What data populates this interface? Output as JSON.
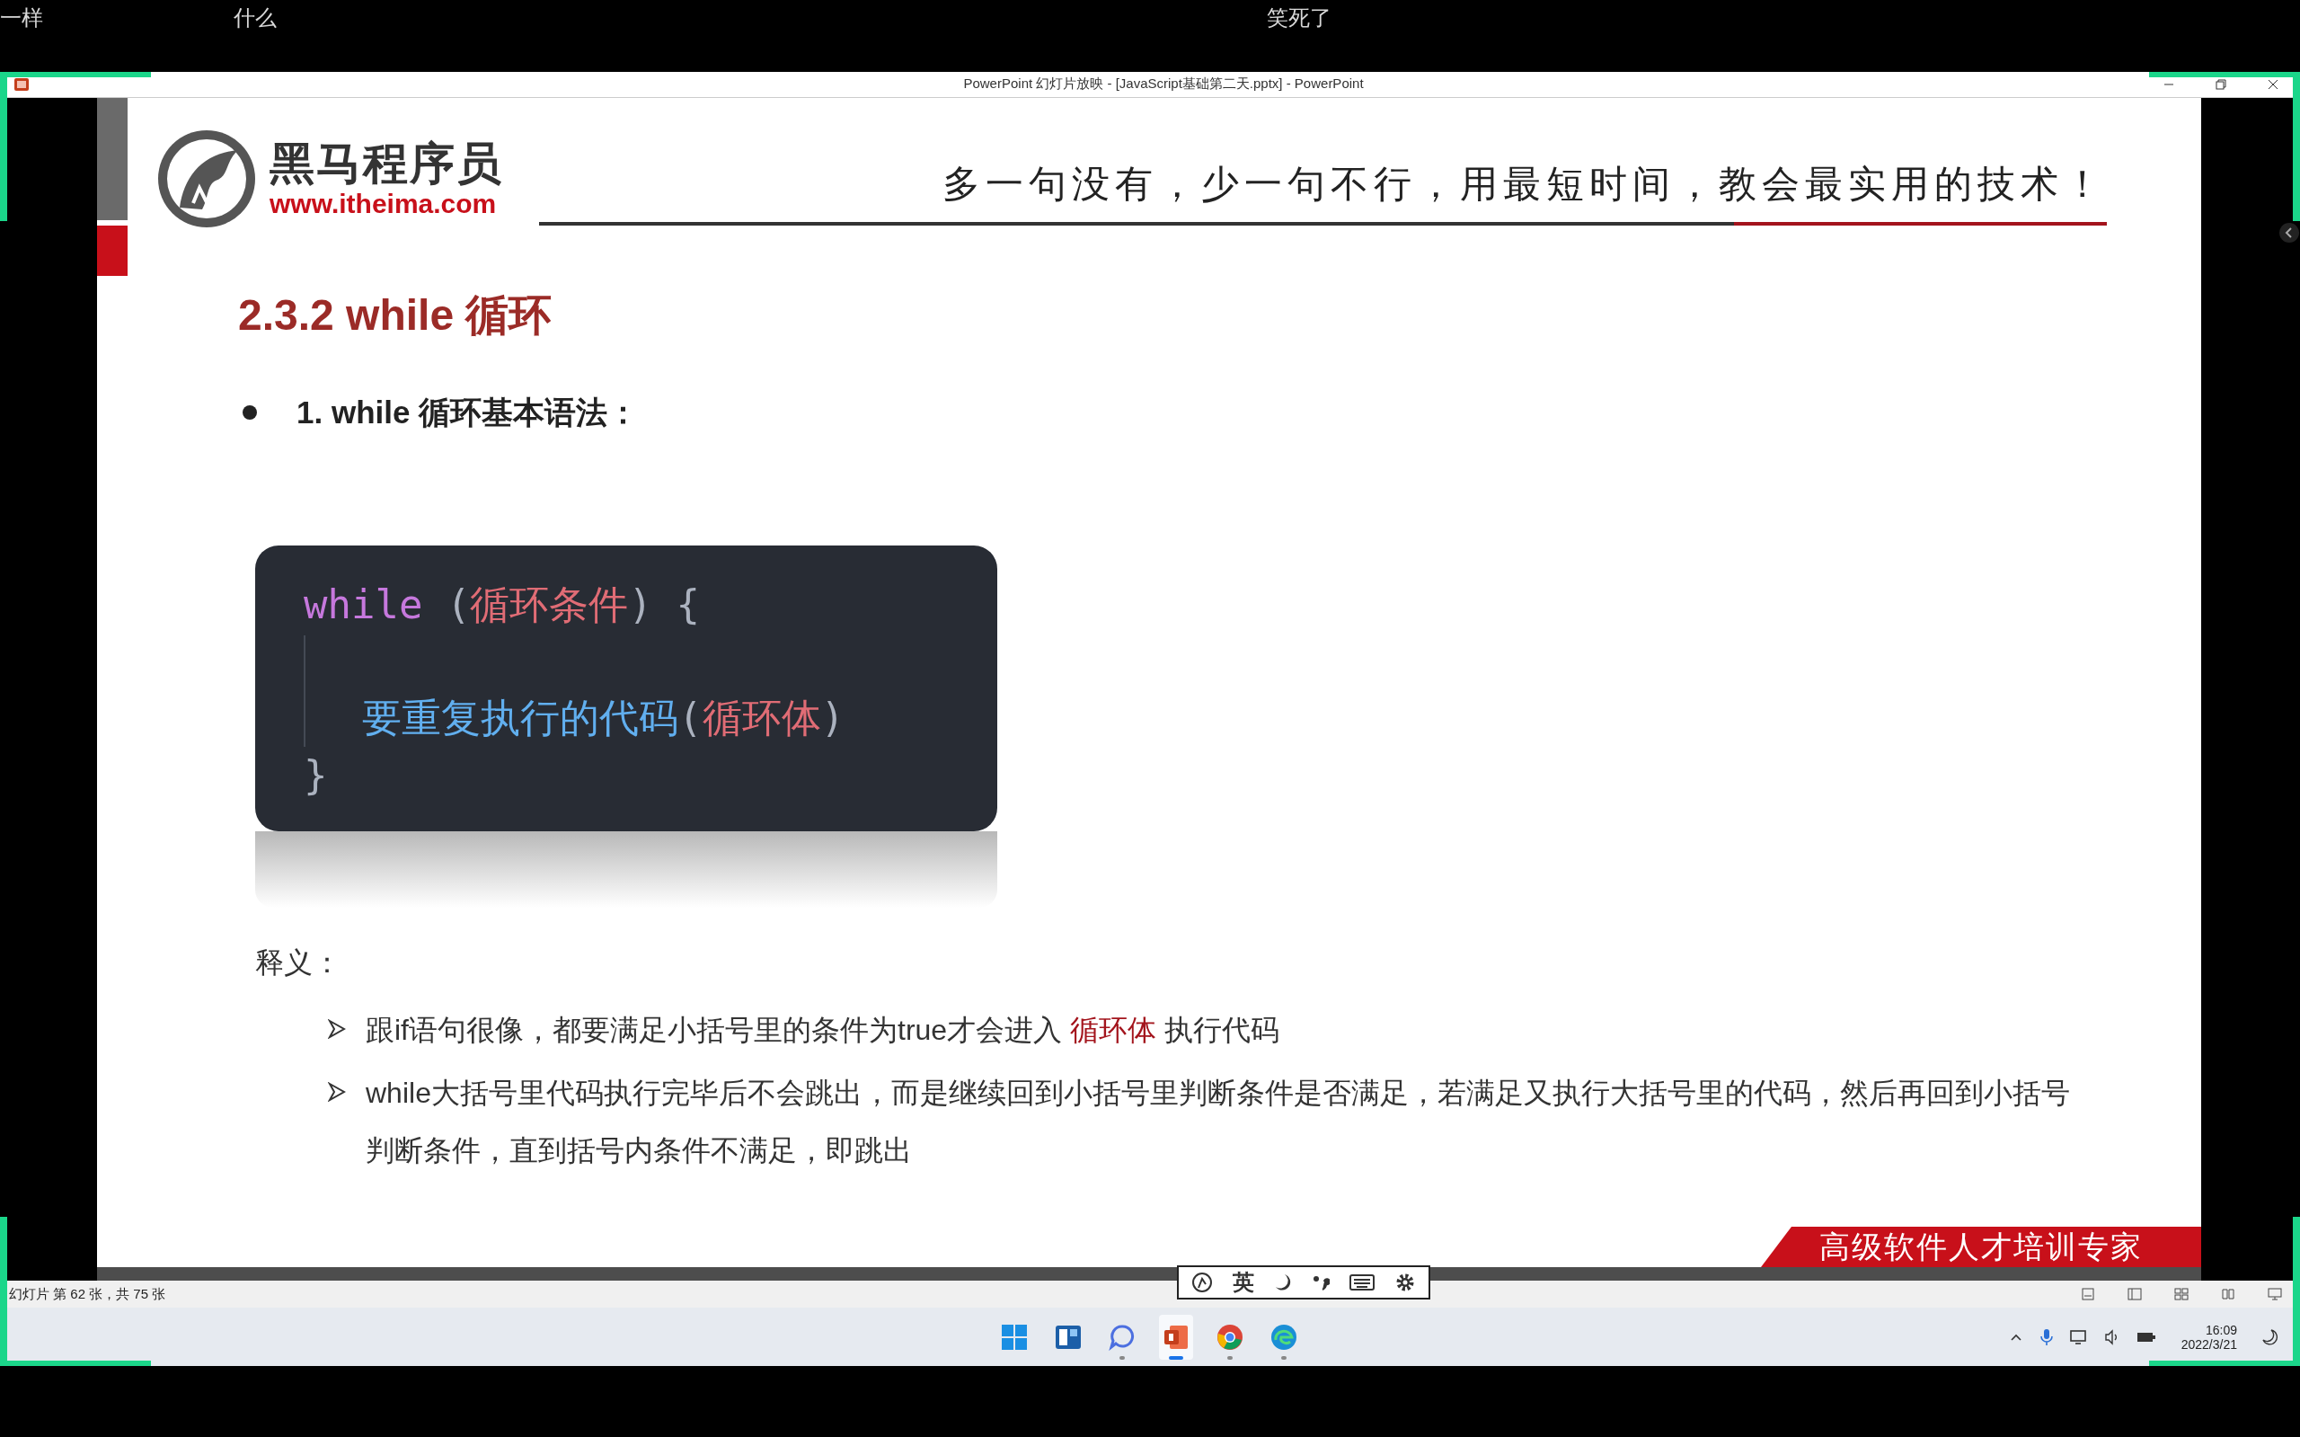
{
  "overlay_comments": [
    {
      "text": "一样"
    },
    {
      "text": "什么"
    },
    {
      "text": "笑死了"
    }
  ],
  "window": {
    "title": "PowerPoint 幻灯片放映 - [JavaScript基础第二天.pptx] - PowerPoint"
  },
  "slide": {
    "logo": {
      "name": "黑马程序员",
      "url": "www.itheima.com"
    },
    "slogan": "多一句没有，少一句不行，用最短时间，教会最实用的技术！",
    "heading": "2.3.2 while 循环",
    "bullet": "1. while 循环基本语法：",
    "code": [
      {
        "indent": false,
        "tokens": [
          {
            "kind": "keyword",
            "text": "while"
          },
          {
            "kind": "punct",
            "text": " ("
          },
          {
            "kind": "param",
            "text": "循环条件"
          },
          {
            "kind": "punct",
            "text": ") {"
          }
        ]
      },
      {
        "indent": true,
        "tokens": [
          {
            "kind": "body",
            "text": "要重复执行的代码"
          },
          {
            "kind": "punct",
            "text": "("
          },
          {
            "kind": "param",
            "text": "循环体"
          },
          {
            "kind": "punct",
            "text": ")"
          }
        ]
      },
      {
        "indent": false,
        "tokens": [
          {
            "kind": "punct",
            "text": "}"
          }
        ]
      }
    ],
    "explanation_label": "释义：",
    "points": [
      [
        {
          "kind": "plain",
          "text": "跟if语句很像，都要满足小括号里的条件为true才会进入 "
        },
        {
          "kind": "highlight",
          "text": "循环体"
        },
        {
          "kind": "plain",
          "text": " 执行代码"
        }
      ],
      [
        {
          "kind": "plain",
          "text": "while大括号里代码执行完毕后不会跳出，而是继续回到小括号里判断条件是否满足，若满足又执行大括号里的代码，然后再回到小括号判断条件，直到括号内条件不满足，即跳出"
        }
      ]
    ],
    "banner": "高级软件人才培训专家"
  },
  "ime_toolbar": {
    "mode": "英"
  },
  "status_bar": {
    "slide_info": "幻灯片 第 62 张，共 75 张"
  },
  "taskbar": {
    "apps": [
      {
        "kind": "start",
        "running": false,
        "active": false
      },
      {
        "kind": "widgets",
        "running": false,
        "active": false
      },
      {
        "kind": "chat",
        "running": true,
        "active": false
      },
      {
        "kind": "powerpoint",
        "running": true,
        "active": true
      },
      {
        "kind": "chrome",
        "running": true,
        "active": false
      },
      {
        "kind": "edge",
        "running": true,
        "active": false
      }
    ],
    "time": "16:09",
    "date": "2022/3/21"
  }
}
